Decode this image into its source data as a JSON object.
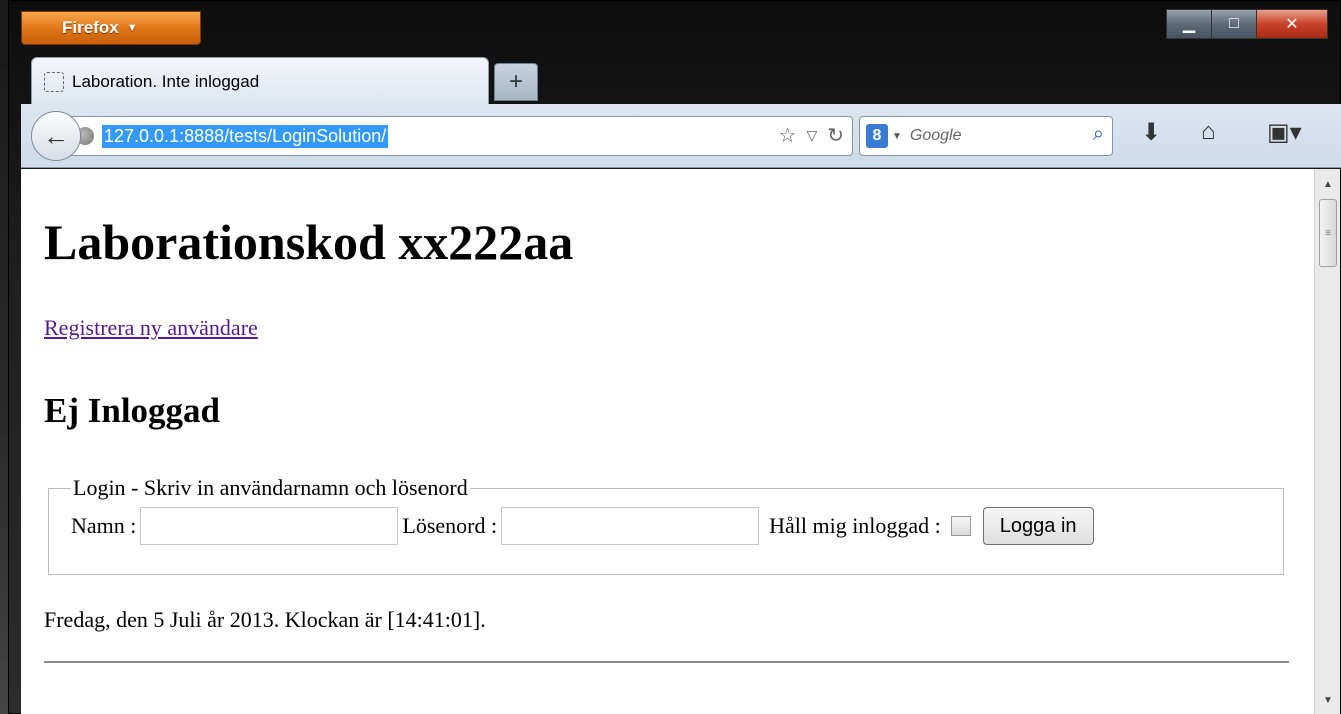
{
  "browser": {
    "menu_button": "Firefox",
    "tab_title": "Laboration. Inte inloggad",
    "new_tab_symbol": "+",
    "url": "127.0.0.1:8888/tests/LoginSolution/",
    "search_engine_badge": "8",
    "search_placeholder": "Google",
    "window_controls": [
      "minimize",
      "maximize",
      "close"
    ]
  },
  "page": {
    "heading": "Laborationskod xx222aa",
    "register_link": "Registrera ny användare",
    "status_heading": "Ej Inloggad",
    "form": {
      "legend": "Login - Skriv in användarnamn och lösenord",
      "name_label": "Namn :",
      "name_value": "",
      "password_label": "Lösenord :",
      "password_value": "",
      "remember_label": "Håll mig inloggad :",
      "remember_checked": false,
      "submit_label": "Logga in"
    },
    "datetime_text": "Fredag, den 5 Juli år 2013. Klockan är [14:41:01]."
  },
  "icons": {
    "back": "back-arrow-icon",
    "site": "globe-icon",
    "bookmark": "star-icon",
    "reload": "reload-icon",
    "search": "magnifier-icon",
    "downloads": "download-arrow-icon",
    "home": "home-icon",
    "bookmarks_menu": "bookmarks-icon"
  }
}
